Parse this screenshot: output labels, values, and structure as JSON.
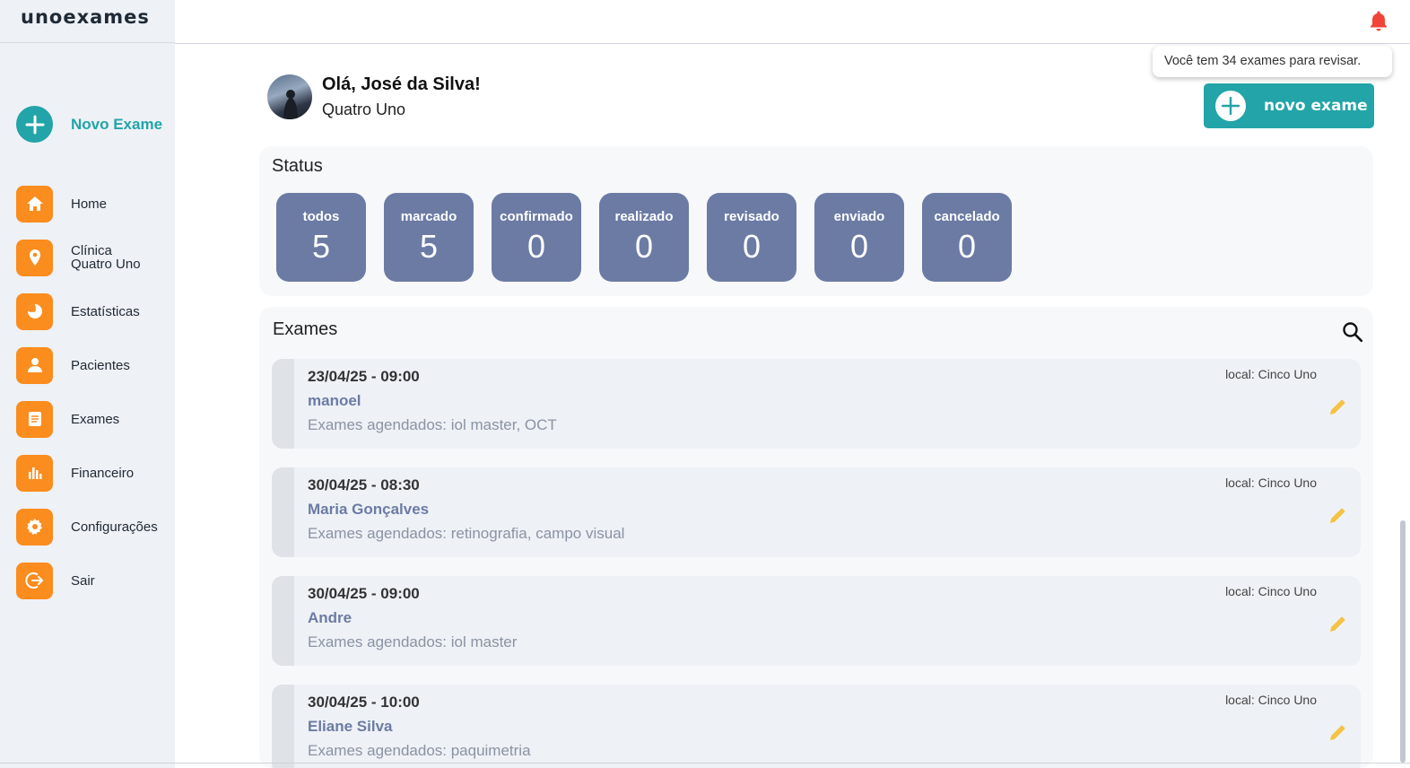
{
  "app": {
    "logo": "unoexames"
  },
  "sidebar": {
    "new_exam_label": "Novo Exame",
    "items": [
      {
        "label": "Home",
        "icon": "home-icon"
      },
      {
        "label": "Clínica",
        "label2": "Quatro Uno",
        "icon": "location-pin-icon"
      },
      {
        "label": "Estatísticas",
        "icon": "pie-chart-icon"
      },
      {
        "label": "Pacientes",
        "icon": "person-icon"
      },
      {
        "label": "Exames",
        "icon": "document-icon"
      },
      {
        "label": "Financeiro",
        "icon": "bar-chart-icon"
      },
      {
        "label": "Configurações",
        "icon": "gear-icon"
      },
      {
        "label": "Sair",
        "icon": "logout-icon"
      }
    ]
  },
  "notification": {
    "tooltip": "Você tem 34 exames para revisar."
  },
  "header": {
    "greeting": "Olá, José da Silva!",
    "clinic": "Quatro Uno",
    "new_exam_button": "novo exame"
  },
  "status": {
    "title": "Status",
    "items": [
      {
        "label": "todos",
        "count": "5"
      },
      {
        "label": "marcado",
        "count": "5"
      },
      {
        "label": "confirmado",
        "count": "0"
      },
      {
        "label": "realizado",
        "count": "0"
      },
      {
        "label": "revisado",
        "count": "0"
      },
      {
        "label": "enviado",
        "count": "0"
      },
      {
        "label": "cancelado",
        "count": "0"
      }
    ]
  },
  "exams": {
    "title": "Exames",
    "items": [
      {
        "datetime": "23/04/25 - 09:00",
        "patient": "manoel",
        "scheduled": "Exames agendados: iol master, OCT",
        "location": "local: Cinco Uno"
      },
      {
        "datetime": "30/04/25 - 08:30",
        "patient": "Maria Gonçalves",
        "scheduled": "Exames agendados: retinografia, campo visual",
        "location": "local: Cinco Uno"
      },
      {
        "datetime": "30/04/25 - 09:00",
        "patient": "Andre",
        "scheduled": "Exames agendados: iol master",
        "location": "local: Cinco Uno"
      },
      {
        "datetime": "30/04/25 - 10:00",
        "patient": "Eliane Silva",
        "scheduled": "Exames agendados: paquimetria",
        "location": "local: Cinco Uno"
      }
    ]
  },
  "colors": {
    "teal": "#22a4a8",
    "orange": "#fb8c1e",
    "status_blue": "#6b7ba4",
    "bell_red": "#f04438",
    "pencil_yellow": "#f5c242"
  }
}
